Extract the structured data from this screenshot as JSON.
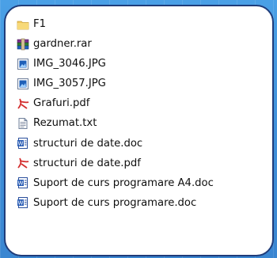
{
  "file_list": [
    {
      "name": "F1",
      "icon": "folder-icon"
    },
    {
      "name": "gardner.rar",
      "icon": "rar-archive-icon"
    },
    {
      "name": "IMG_3046.JPG",
      "icon": "image-file-icon"
    },
    {
      "name": "IMG_3057.JPG",
      "icon": "image-file-icon"
    },
    {
      "name": "Grafuri.pdf",
      "icon": "pdf-file-icon"
    },
    {
      "name": "Rezumat.txt",
      "icon": "text-file-icon"
    },
    {
      "name": "structuri de date.doc",
      "icon": "word-doc-icon"
    },
    {
      "name": "structuri de date.pdf",
      "icon": "pdf-file-icon"
    },
    {
      "name": "Suport de curs programare A4.doc",
      "icon": "word-doc-icon"
    },
    {
      "name": "Suport de curs programare.doc",
      "icon": "word-doc-icon"
    }
  ]
}
